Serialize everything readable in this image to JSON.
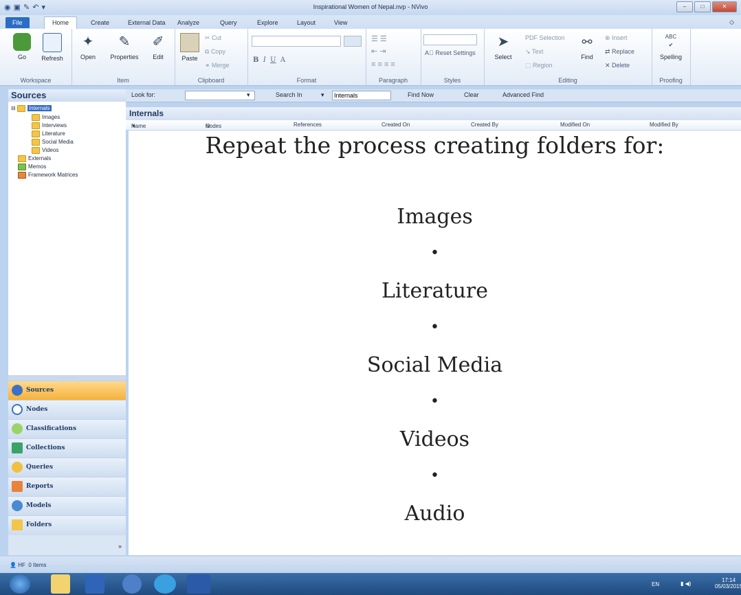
{
  "window": {
    "title": "Inspirational Women of Nepal.nvp - NVivo"
  },
  "tabs": [
    "File",
    "Home",
    "Create",
    "External Data",
    "Analyze",
    "Query",
    "Explore",
    "Layout",
    "View"
  ],
  "ribbon": {
    "workspace": {
      "label": "Workspace",
      "go": "Go",
      "refresh": "Refresh"
    },
    "item": {
      "label": "Item",
      "open": "Open",
      "properties": "Properties",
      "edit": "Edit"
    },
    "clipboard": {
      "label": "Clipboard",
      "paste": "Paste",
      "cut": "Cut",
      "copy": "Copy",
      "merge": "Merge"
    },
    "format": {
      "label": "Format",
      "bold": "B",
      "italic": "I",
      "underline": "U",
      "fontcolor": "A"
    },
    "paragraph": {
      "label": "Paragraph"
    },
    "styles": {
      "label": "Styles",
      "reset": "Reset Settings"
    },
    "editing": {
      "label": "Editing",
      "select": "Select",
      "pdf": "PDF Selection",
      "text": "Text",
      "region": "Region",
      "find": "Find",
      "insert": "Insert",
      "replace": "Replace",
      "delete": "Delete"
    },
    "proofing": {
      "label": "Proofing",
      "spelling": "Spelling",
      "abc": "ABC"
    }
  },
  "findbar": {
    "lookfor": "Look for:",
    "searchin": "Search In",
    "scope": "Internals",
    "findnow": "Find Now",
    "clear": "Clear",
    "advanced": "Advanced Find"
  },
  "nav": {
    "title": "Sources",
    "tree": {
      "root": "Internals",
      "children": [
        "Images",
        "Interviews",
        "Literature",
        "Social Media",
        "Videos"
      ],
      "others": [
        "Externals",
        "Memos",
        "Framework Matrices"
      ]
    },
    "buttons": [
      "Sources",
      "Nodes",
      "Classifications",
      "Collections",
      "Queries",
      "Reports",
      "Models",
      "Folders"
    ]
  },
  "list": {
    "title": "Internals",
    "columns": [
      "Name",
      "Nodes",
      "References",
      "Created On",
      "Created By",
      "Modified On",
      "Modified By"
    ]
  },
  "slide": {
    "heading": "Repeat the process creating folders for:",
    "items": [
      "Images",
      "Literature",
      "Social Media",
      "Videos",
      "Audio"
    ],
    "bullet": "•"
  },
  "status": {
    "user": "HF",
    "items": "0 Items"
  },
  "taskbar": {
    "lang": "EN",
    "time": "17:14",
    "date": "05/03/2015"
  }
}
